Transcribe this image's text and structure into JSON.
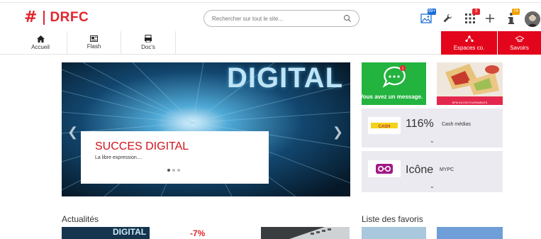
{
  "header": {
    "logo_hash": "#",
    "logo_text": "DRFC",
    "search_placeholder": "Rechercher sur tout le site...",
    "badges": {
      "images": "99+",
      "apps": "3",
      "notifications": "74"
    },
    "colors": {
      "brand_red": "#e3262d",
      "nav_red": "#e3051b"
    }
  },
  "nav": {
    "items": [
      {
        "label": "Accueil",
        "icon": "home-icon"
      },
      {
        "label": "Flash",
        "icon": "newspaper-icon"
      },
      {
        "label": "Doc's",
        "icon": "document-icon"
      }
    ],
    "red_items": [
      {
        "label": "Espaces co.",
        "icon": "people-network-icon"
      },
      {
        "label": "Savoirs",
        "icon": "graduation-cap-icon"
      }
    ]
  },
  "hero": {
    "banner_word": "DIGITAL",
    "title": "SUCCES DIGITAL",
    "subtitle": "La libre expression....",
    "slide_count": 3,
    "active_slide": 1
  },
  "tiles": {
    "message_text": "Vous avez un message.",
    "food_text": "BFM INCONTOURNABLES"
  },
  "cards": [
    {
      "big": "116%",
      "small": "Cash médias",
      "logo": "CASH MÉDIAS"
    },
    {
      "big": "Icône",
      "small": "MYPC",
      "logo": "mypc-icon"
    }
  ],
  "sections": {
    "news_title": "Actualités",
    "favorites_title": "Liste des favoris",
    "news_thumb_1": "DIGITAL",
    "news_thumb_2": "-7%"
  }
}
